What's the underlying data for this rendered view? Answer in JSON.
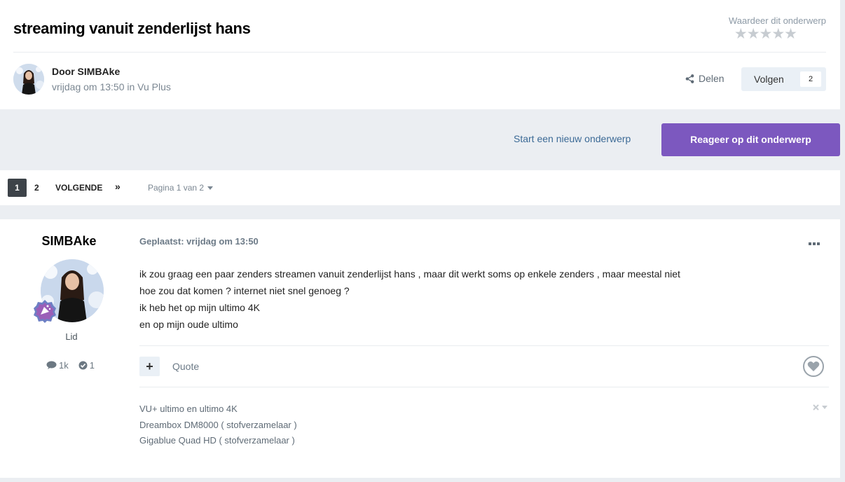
{
  "topic": {
    "title": "streaming vanuit zenderlijst hans",
    "rate_label": "Waardeer dit onderwerp",
    "stars": [
      "★",
      "★",
      "★",
      "★",
      "★"
    ],
    "author_line": "Door SIMBAke",
    "meta_line": "vrijdag om 13:50 in Vu Plus",
    "share_label": "Delen",
    "follow_label": "Volgen",
    "follow_count": "2"
  },
  "actions": {
    "start_label": "Start een nieuw onderwerp",
    "reply_label": "Reageer op dit onderwerp"
  },
  "pagination": {
    "current": "1",
    "page2": "2",
    "next_label": "VOLGENDE",
    "last_label": "»",
    "page_of": "Pagina 1 van 2"
  },
  "post": {
    "author": "SIMBAke",
    "role": "Lid",
    "posts_count": "1k",
    "reputation": "1",
    "date": "Geplaatst: vrijdag om 13:50",
    "body": [
      "ik zou graag een paar zenders streamen vanuit zenderlijst hans , maar dit werkt soms op enkele zenders , maar meestal niet",
      "hoe zou dat komen ? internet niet snel genoeg ?",
      "ik heb het op mijn ultimo 4K",
      "en op mijn oude ultimo"
    ],
    "quote_label": "Quote",
    "signature": [
      "VU+ ultimo en ultimo 4K",
      "Dreambox DM8000 ( stofverzamelaar )",
      "Gigablue Quad HD ( stofverzamelaar )"
    ]
  },
  "colors": {
    "accent": "#7c58bf",
    "link": "#3c6a96",
    "background": "#ebeef2"
  },
  "icons": [
    "star-icon",
    "share-icon",
    "comment-icon",
    "check-circle-icon",
    "plus-icon",
    "heart-icon",
    "ellipsis-icon",
    "close-icon",
    "chevron-down-icon"
  ]
}
